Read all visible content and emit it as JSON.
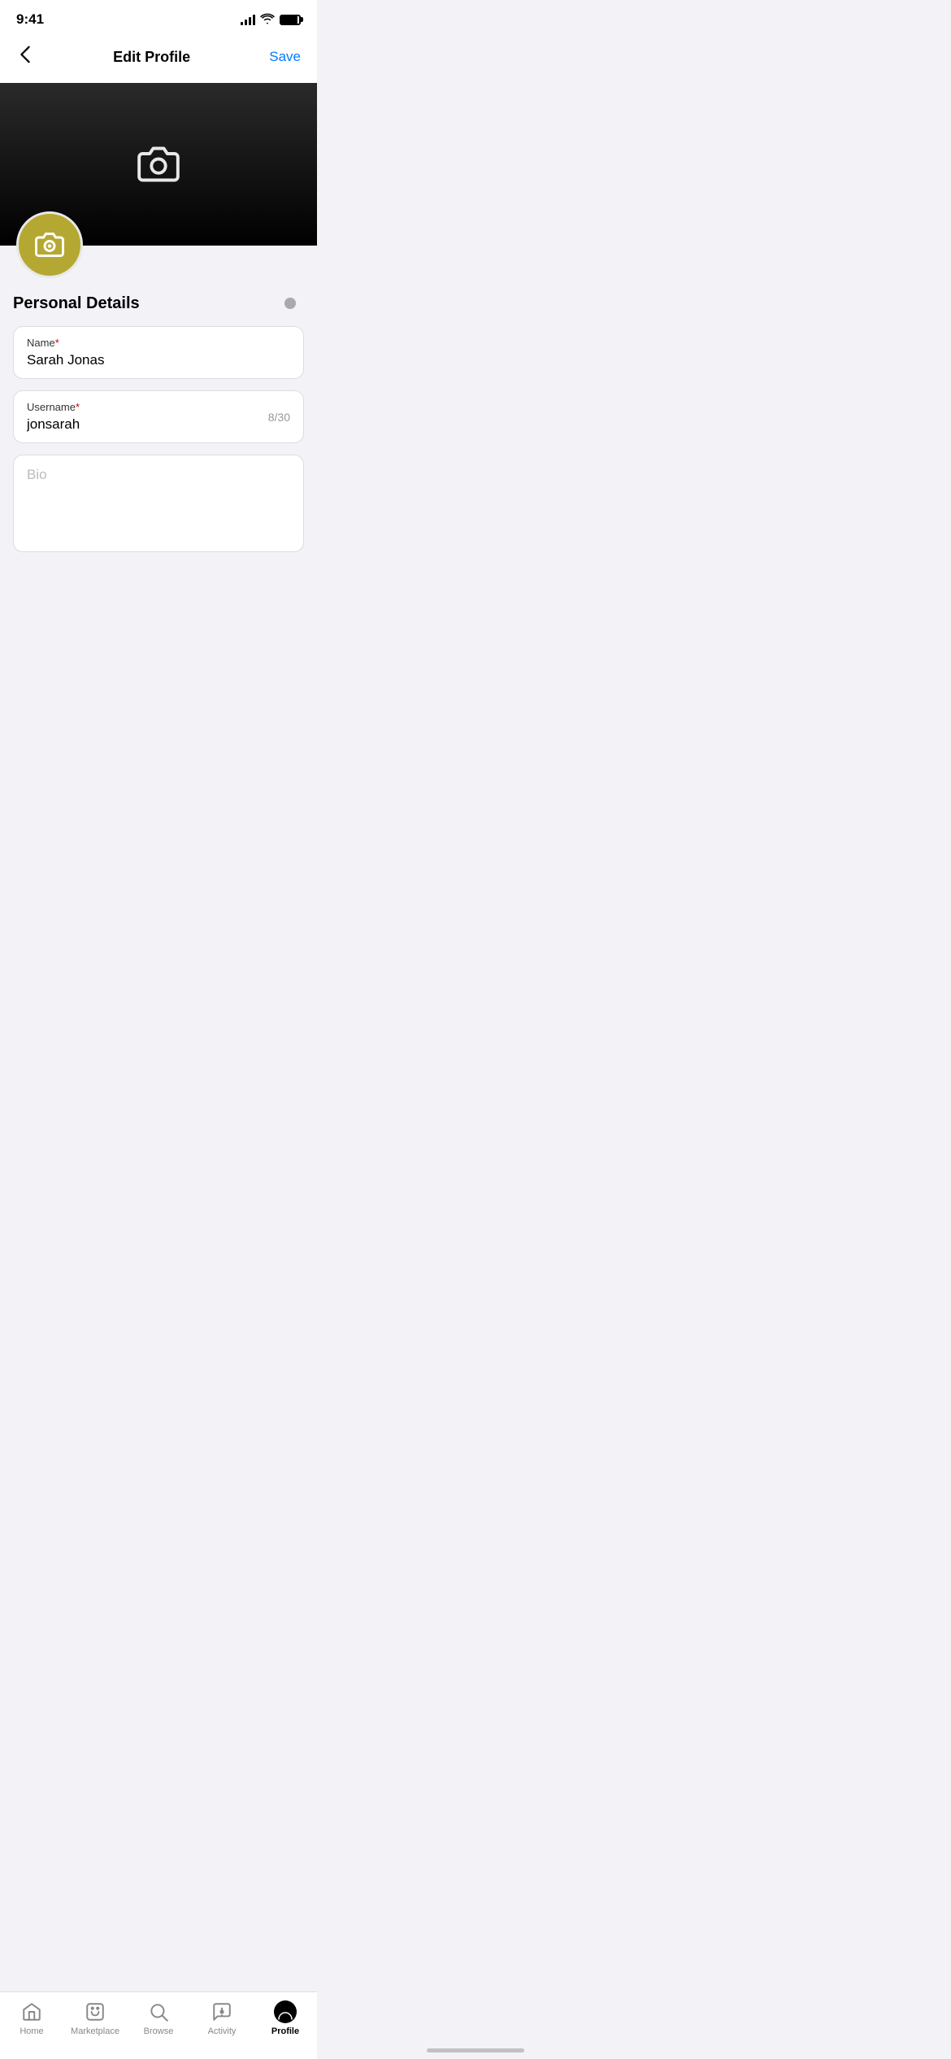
{
  "statusBar": {
    "time": "9:41"
  },
  "header": {
    "back_label": "‹",
    "title": "Edit Profile",
    "save_label": "Save"
  },
  "banner": {
    "camera_icon": "camera"
  },
  "avatar": {
    "camera_icon": "camera"
  },
  "personalDetails": {
    "section_title": "Personal Details",
    "nameField": {
      "label": "Name",
      "required": true,
      "value": "Sarah Jonas"
    },
    "usernameField": {
      "label": "Username",
      "required": true,
      "value": "jonsarah",
      "counter": "8/30"
    },
    "bioField": {
      "placeholder": "Bio"
    }
  },
  "tabBar": {
    "items": [
      {
        "id": "home",
        "label": "Home",
        "active": false
      },
      {
        "id": "marketplace",
        "label": "Marketplace",
        "active": false
      },
      {
        "id": "browse",
        "label": "Browse",
        "active": false
      },
      {
        "id": "activity",
        "label": "Activity",
        "active": false
      },
      {
        "id": "profile",
        "label": "Profile",
        "active": true
      }
    ]
  }
}
